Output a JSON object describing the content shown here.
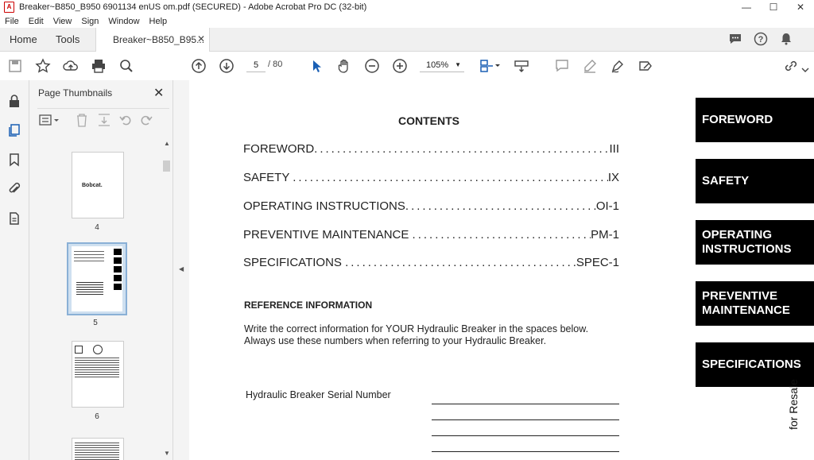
{
  "window": {
    "title": "Breaker~B850_B950 6901134 enUS om.pdf (SECURED) - Adobe Acrobat Pro DC (32-bit)",
    "minimize": "—",
    "maximize": "☐",
    "close": "✕"
  },
  "menu": [
    "File",
    "Edit",
    "View",
    "Sign",
    "Window",
    "Help"
  ],
  "tabs": {
    "home": "Home",
    "tools": "Tools",
    "doc": "Breaker~B850_B95...",
    "doc_close": "✕"
  },
  "toolbar": {
    "page_current": "5",
    "page_total": "/ 80",
    "zoom": "105%"
  },
  "thumbnails": {
    "title": "Page Thumbnails",
    "close": "✕",
    "pages": [
      {
        "num": "4",
        "logo": "Bobcat."
      },
      {
        "num": "5"
      },
      {
        "num": "6"
      }
    ]
  },
  "document": {
    "contents_title": "CONTENTS",
    "toc": [
      {
        "title": "FOREWORD",
        "page": "III"
      },
      {
        "title": "SAFETY ",
        "page": "IX"
      },
      {
        "title": "OPERATING INSTRUCTIONS",
        "page": "OI-1"
      },
      {
        "title": "PREVENTIVE MAINTENANCE ",
        "page": "PM-1"
      },
      {
        "title": "SPECIFICATIONS ",
        "page": "SPEC-1"
      }
    ],
    "ref_title": "REFERENCE INFORMATION",
    "ref_line1": "Write  the correct information for YOUR Hydraulic Breaker in the spaces below.",
    "ref_line2": "Always use these numbers when referring to your Hydraulic Breaker.",
    "serial_label": "Hydraulic Breaker Serial Number",
    "side_tabs": [
      {
        "line1": "FOREWORD",
        "line2": ""
      },
      {
        "line1": "SAFETY",
        "line2": ""
      },
      {
        "line1": "OPERATING",
        "line2": "INSTRUCTIONS"
      },
      {
        "line1": "PREVENTIVE",
        "line2": "MAINTENANCE"
      },
      {
        "line1": "SPECIFICATIONS",
        "line2": ""
      }
    ],
    "vertical_text": "for Resale"
  }
}
